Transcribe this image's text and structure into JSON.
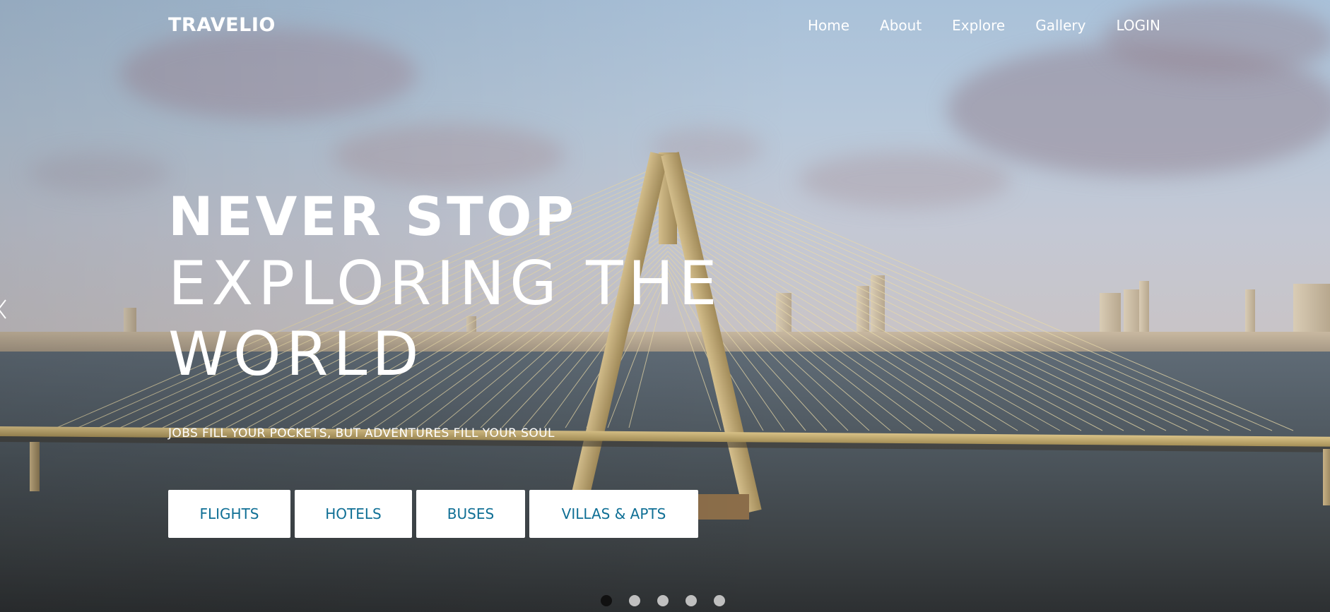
{
  "brand": {
    "name": "TRAVELIO"
  },
  "nav": {
    "items": [
      {
        "label": "Home"
      },
      {
        "label": "About"
      },
      {
        "label": "Explore"
      },
      {
        "label": "Gallery"
      },
      {
        "label": "LOGIN"
      }
    ]
  },
  "hero": {
    "line1": "NEVER STOP",
    "line2": "EXPLORING THE",
    "line3": "WORLD",
    "tagline": "JOBS FILL YOUR POCKETS, BUT ADVENTURES FILL YOUR SOUL"
  },
  "services": [
    {
      "label": "FLIGHTS"
    },
    {
      "label": "HOTELS"
    },
    {
      "label": "BUSES"
    },
    {
      "label": "VILLAS & APTS"
    }
  ],
  "carousel": {
    "slide_count": 5,
    "active_index": 0,
    "prev_icon": "chevron-left-icon"
  },
  "colors": {
    "service_text": "#0f6f95",
    "service_bg": "#ffffff",
    "nav_text": "#ffffff",
    "dot_active": "#111111",
    "dot_inactive": "#bfbfbf"
  }
}
